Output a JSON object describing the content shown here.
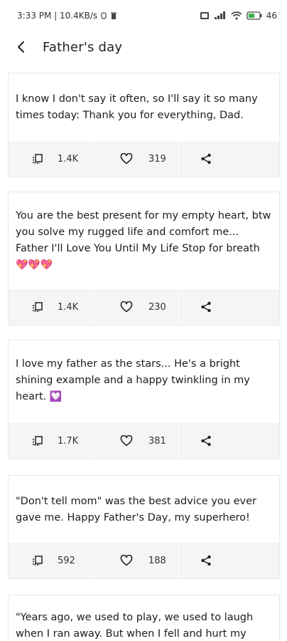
{
  "status": {
    "time_net": "3:33 PM | 10.4KB/s",
    "battery": "46"
  },
  "header": {
    "title": "Father's day"
  },
  "cards": [
    {
      "text": "I know I don't say it often, so I'll say it so many times today: Thank you for everything, Dad.",
      "copies": "1.4K",
      "likes": "319"
    },
    {
      "text": "You are the best present for my empty heart, btw you solve my rugged life and comfort me... Father I'll Love You Until My Life Stop for breath",
      "emoji": "💖💖💖",
      "copies": "1.4K",
      "likes": "230"
    },
    {
      "text": "I love my father as the stars... He's a bright shining example and a happy twinkling in my heart.",
      "emoji": "💟",
      "copies": "1.7K",
      "likes": "381"
    },
    {
      "text": "\"Don't tell mom\" was the best advice you ever gave me. Happy Father's Day, my superhero!",
      "copies": "592",
      "likes": "188"
    },
    {
      "text": "\"Years ago, we used to play, we used to laugh when I ran away. But when I fell and hurt my"
    }
  ],
  "colors": {
    "action_bar": "#f5f5f5",
    "card_border": "#e8e8e8",
    "icon": "#222222"
  }
}
